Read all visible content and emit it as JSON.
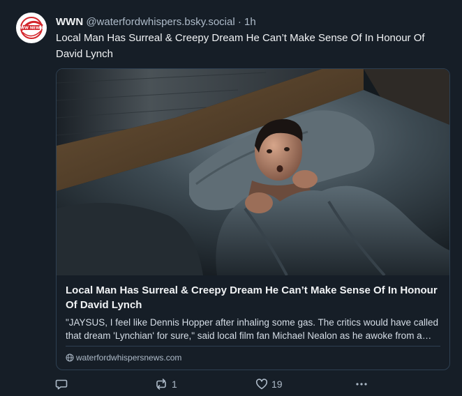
{
  "post": {
    "display_name": "WWN",
    "handle": "@waterfordwhispers.bsky.social",
    "separator": "·",
    "time": "1h",
    "text": "Local Man Has Surreal & Creepy Dream He Can’t Make Sense Of In Honour Of David Lynch",
    "avatar": {
      "badge_text": "WW NEWS",
      "accent_color": "#d3262b"
    }
  },
  "card": {
    "title": "Local Man Has Surreal & Creepy Dream He Can’t Make Sense Of In Honour Of David Lynch",
    "description": "\"JAYSUS, I feel like Dennis Hopper after inhaling some gas. The critics would have called that dream 'Lynchian' for sure,\" said local film fan Michael Nealon as he awoke from a dream",
    "domain": "waterfordwhispersnews.com",
    "image_alt": "Frightened man lying awake in bed at night holding the covers"
  },
  "actions": {
    "reply": {
      "icon": "reply-icon",
      "count": ""
    },
    "repost": {
      "icon": "repost-icon",
      "count": "1"
    },
    "like": {
      "icon": "heart-icon",
      "count": "19"
    },
    "more": {
      "icon": "more-icon"
    }
  },
  "colors": {
    "background": "#161e27",
    "text": "#f1f3f5",
    "muted": "#aebbc9",
    "border": "#2e4052"
  }
}
